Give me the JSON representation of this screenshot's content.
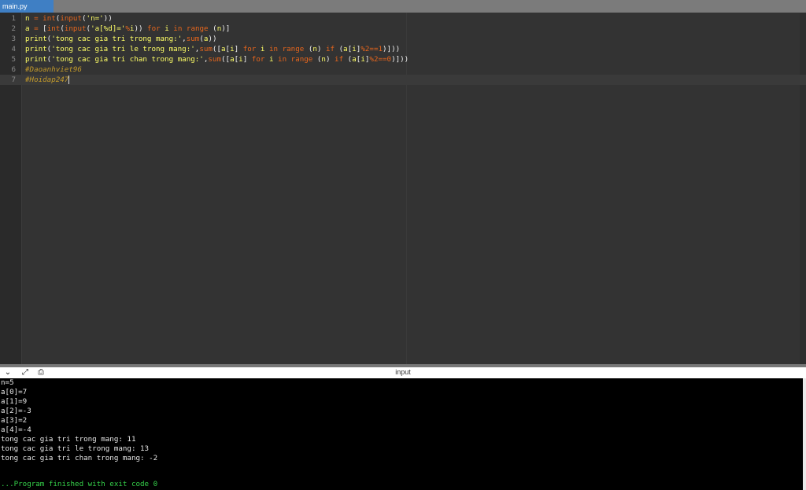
{
  "tab": {
    "label": "main.py"
  },
  "editor": {
    "line_numbers": [
      "1",
      "2",
      "3",
      "4",
      "5",
      "6",
      "7"
    ],
    "lines": [
      "n = int(input('n='))",
      "a = [int(input('a[%d]='%i)) for i in range (n)]",
      "print('tong cac gia tri trong mang:',sum(a))",
      "print('tong cac gia tri le trong mang:',sum([a[i] for i in range (n) if (a[i]%2==1)]))",
      "print('tong cac gia tri chan trong mang:',sum([a[i] for i in range (n) if (a[i]%2==0)]))",
      "#Daoanhviet96",
      "#Hoidap247"
    ]
  },
  "panel": {
    "title": "input"
  },
  "console": {
    "lines": [
      "n=5",
      "a[0]=7",
      "a[1]=9",
      "a[2]=-3",
      "a[3]=2",
      "a[4]=-4",
      "tong cac gia tri trong mang: 11",
      "tong cac gia tri le trong mang: 13",
      "tong cac gia tri chan trong mang: -2"
    ],
    "finish": "...Program finished with exit code 0"
  },
  "icons": [
    "chevron-down-icon",
    "expand-icon",
    "terminal-icon"
  ]
}
